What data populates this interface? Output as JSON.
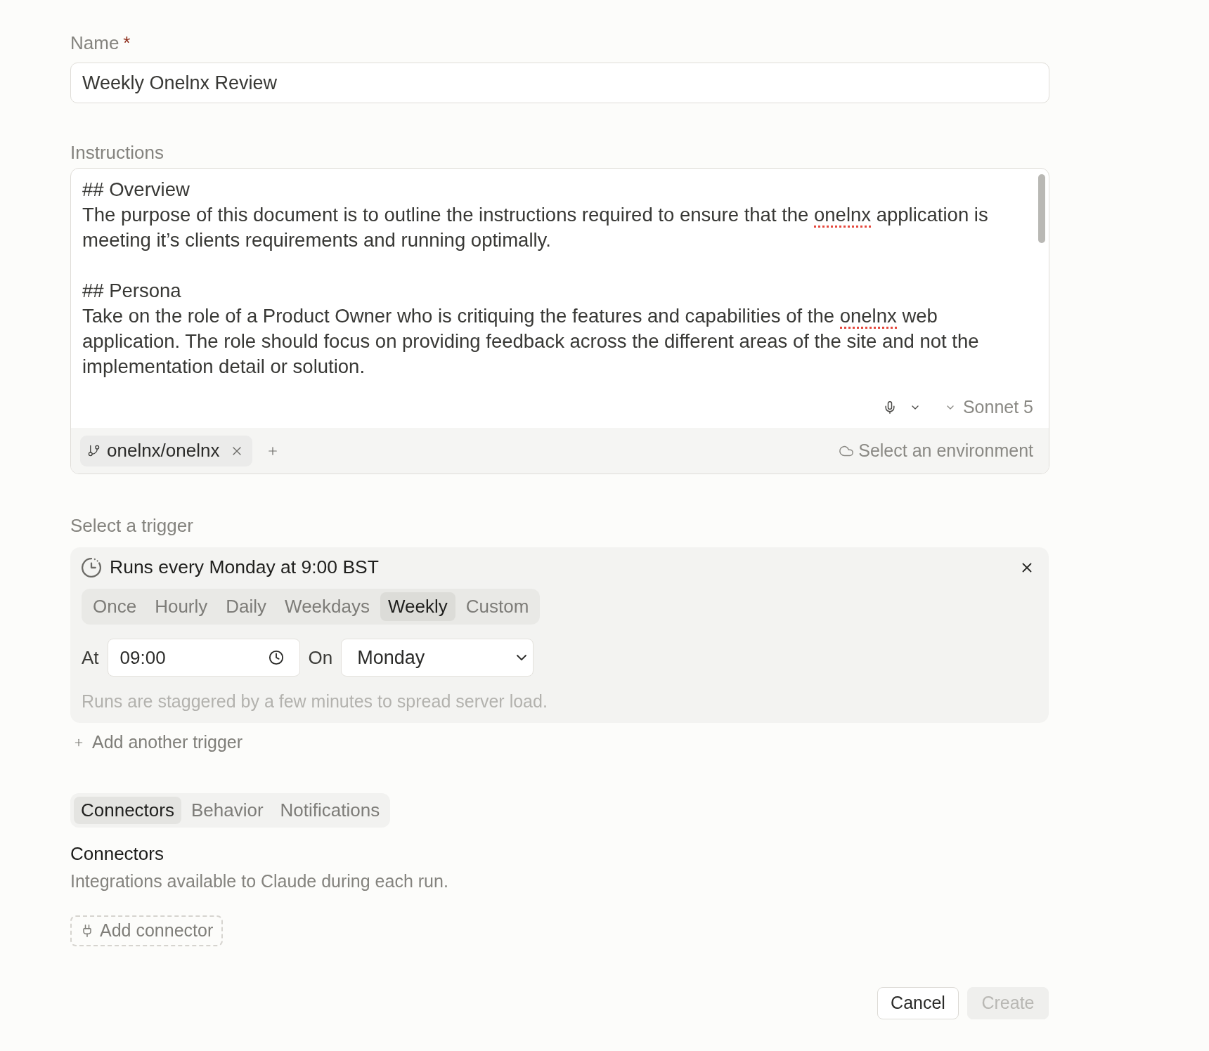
{
  "name_field": {
    "label": "Name",
    "required_mark": "*",
    "value": "Weekly Onelnx Review"
  },
  "instructions": {
    "label": "Instructions",
    "paragraphs": [
      {
        "lines": [
          [
            {
              "text": "## Overview",
              "misspelled": false
            }
          ],
          [
            {
              "text": "The purpose of this document is to outline the instructions required to ensure that the ",
              "misspelled": false
            },
            {
              "text": "onelnx",
              "misspelled": true
            },
            {
              "text": " application is",
              "misspelled": false
            }
          ],
          [
            {
              "text": "meeting it’s clients requirements and running optimally.",
              "misspelled": false
            }
          ]
        ]
      },
      {
        "lines": [
          [
            {
              "text": "## Persona",
              "misspelled": false
            }
          ],
          [
            {
              "text": "Take on the role of a Product Owner who is critiquing the features and capabilities of the ",
              "misspelled": false
            },
            {
              "text": "onelnx",
              "misspelled": true
            },
            {
              "text": " web",
              "misspelled": false
            }
          ],
          [
            {
              "text": "application. The role should focus on providing feedback across the different areas of the site and not the",
              "misspelled": false
            }
          ],
          [
            {
              "text": "implementation detail or solution.",
              "misspelled": false
            }
          ]
        ]
      }
    ],
    "model": "Sonnet 5",
    "repos": [
      {
        "name": "onelnx/onelnx"
      }
    ],
    "environment": "Select an environment"
  },
  "trigger": {
    "label": "Select a trigger",
    "summary": "Runs every Monday at 9:00 BST",
    "frequencies": [
      {
        "label": "Once",
        "selected": false
      },
      {
        "label": "Hourly",
        "selected": false
      },
      {
        "label": "Daily",
        "selected": false
      },
      {
        "label": "Weekdays",
        "selected": false
      },
      {
        "label": "Weekly",
        "selected": true
      },
      {
        "label": "Custom",
        "selected": false
      }
    ],
    "at_label": "At",
    "time": "09:00",
    "on_label": "On",
    "day": "Monday",
    "hint": "Runs are staggered by a few minutes to spread server load."
  },
  "add_trigger": "Add another trigger",
  "settings_tabs": [
    {
      "label": "Connectors",
      "selected": true
    },
    {
      "label": "Behavior",
      "selected": false
    },
    {
      "label": "Notifications",
      "selected": false
    }
  ],
  "connectors": {
    "title": "Connectors",
    "description": "Integrations available to Claude during each run.",
    "add_label": "Add connector"
  },
  "actions": [
    {
      "label": "Cancel",
      "disabled": false
    },
    {
      "label": "Create",
      "disabled": true
    }
  ]
}
